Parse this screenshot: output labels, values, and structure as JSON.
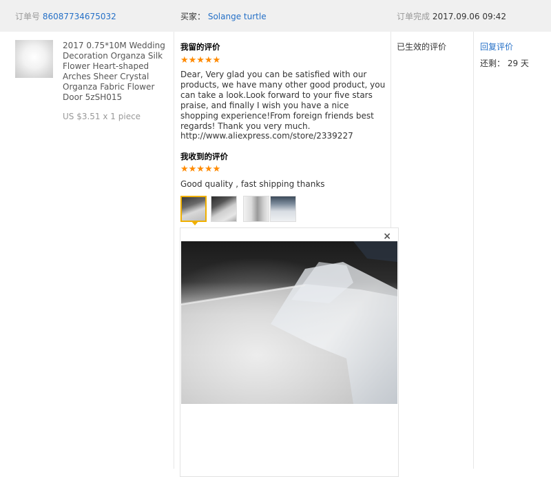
{
  "header": {
    "order_label": "订单号",
    "order_number": "86087734675032",
    "buyer_label": "买家：",
    "buyer_name": "Solange turtle",
    "completed_label": "订单完成",
    "completed_time": "2017.09.06 09:42"
  },
  "product": {
    "title": "2017 0.75*10M Wedding Decoration Organza Silk Flower Heart-shaped Arches Sheer Crystal Organza Fabric Flower Door 5zSH015",
    "price": "US $3.51 x 1 piece"
  },
  "my_review": {
    "title": "我留的评价",
    "stars": "★★★★★",
    "text": "Dear, Very glad you can be satisfied with our products, we have many other good product, you can take a look.Look forward to your five stars praise, and finally I wish you have a nice shopping experience!From foreign friends best regards! Thank you very much. http://www.aliexpress.com/store/2339227"
  },
  "received_review": {
    "title": "我收到的评价",
    "stars": "★★★★★",
    "text": "Good quality , fast shipping thanks",
    "photos": [
      "photo-1",
      "photo-2",
      "photo-3",
      "photo-4"
    ]
  },
  "status": {
    "effective": "已生效的评价"
  },
  "actions": {
    "reply_label": "回复评价",
    "remaining_label": "还剩：",
    "remaining_days": "29 天"
  },
  "preview": {
    "close_label": "×"
  },
  "colors": {
    "link": "#2570c7",
    "star": "#ff8a00",
    "active_thumb": "#f0b000",
    "header_bg": "#f0f0f0"
  }
}
